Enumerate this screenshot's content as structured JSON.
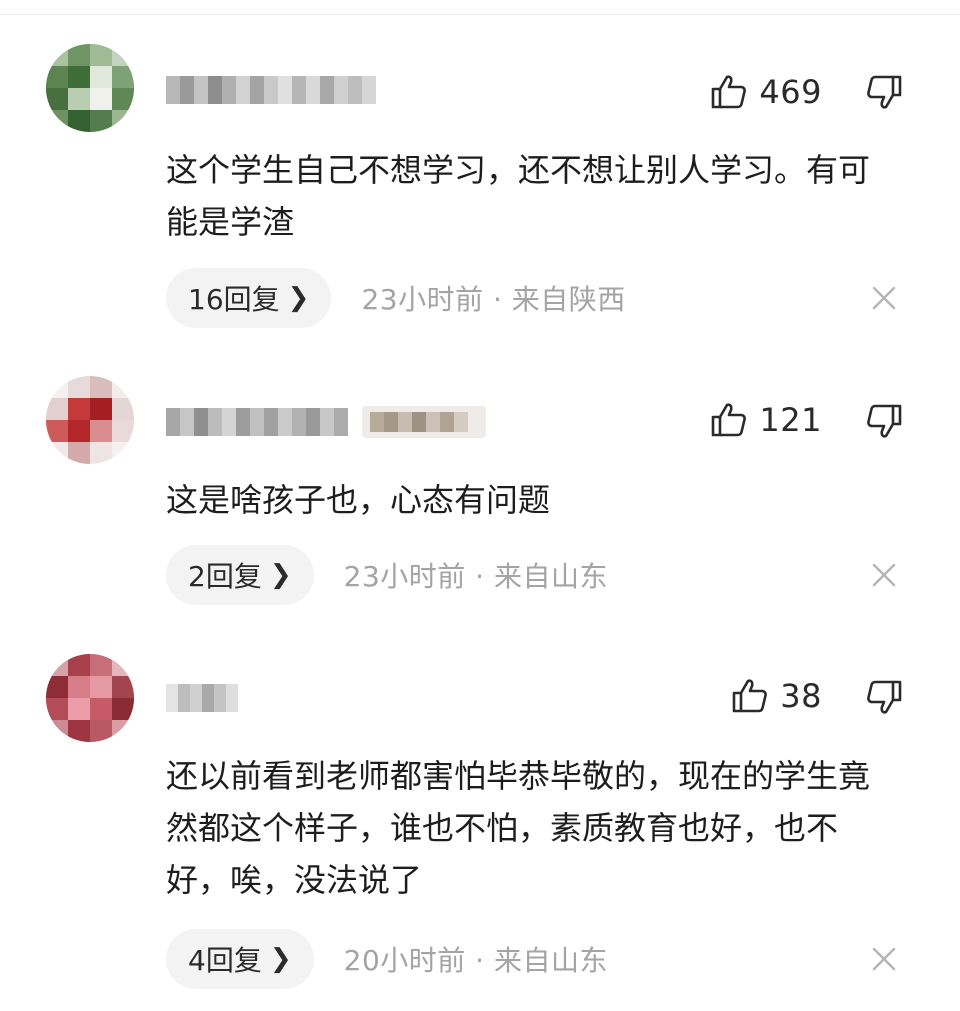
{
  "comments": [
    {
      "like_count": "469",
      "text": "这个学生自己不想学习，还不想让别人学习。有可能是学渣",
      "replies_label": "16回复",
      "time": "23小时前",
      "separator": "·",
      "location": "来自陕西"
    },
    {
      "like_count": "121",
      "text": "这是啥孩子也，心态有问题",
      "replies_label": "2回复",
      "time": "23小时前",
      "separator": "·",
      "location": "来自山东"
    },
    {
      "like_count": "38",
      "text": "还以前看到老师都害怕毕恭毕敬的，现在的学生竟然都这个样子，谁也不怕，素质教育也好，也不好，唉，没法说了",
      "replies_label": "4回复",
      "time": "20小时前",
      "separator": "·",
      "location": "来自山东"
    }
  ],
  "icons": {
    "like": "thumbs-up-icon",
    "dislike": "thumbs-down-icon",
    "chevron": "chevron-right-icon",
    "close": "close-icon"
  },
  "colors": {
    "text": "#1d1d1d",
    "meta": "#a4a4a4",
    "pill_bg": "#f3f3f3"
  }
}
